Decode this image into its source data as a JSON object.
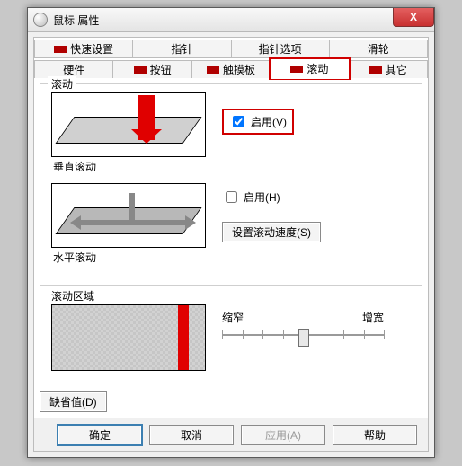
{
  "window": {
    "title": "鼠标 属性",
    "close": "X"
  },
  "tabs": {
    "row1": [
      "快速设置",
      "指针",
      "指针选项",
      "滑轮"
    ],
    "row2": [
      "硬件",
      "按钮",
      "触摸板",
      "滚动",
      "其它"
    ],
    "active": "滚动"
  },
  "scroll_group": {
    "legend": "滚动",
    "vertical": {
      "caption": "垂直滚动",
      "enable_label": "启用(V)",
      "enabled": true
    },
    "horizontal": {
      "caption": "水平滚动",
      "enable_label": "启用(H)",
      "enabled": false
    },
    "speed_button": "设置滚动速度(S)"
  },
  "area_group": {
    "legend": "滚动区域",
    "narrow": "缩窄",
    "widen": "增宽",
    "slider": {
      "min": 0,
      "max": 8,
      "value": 4
    }
  },
  "defaults_button": "缺省值(D)",
  "footer": {
    "ok": "确定",
    "cancel": "取消",
    "apply": "应用(A)",
    "help": "帮助"
  }
}
